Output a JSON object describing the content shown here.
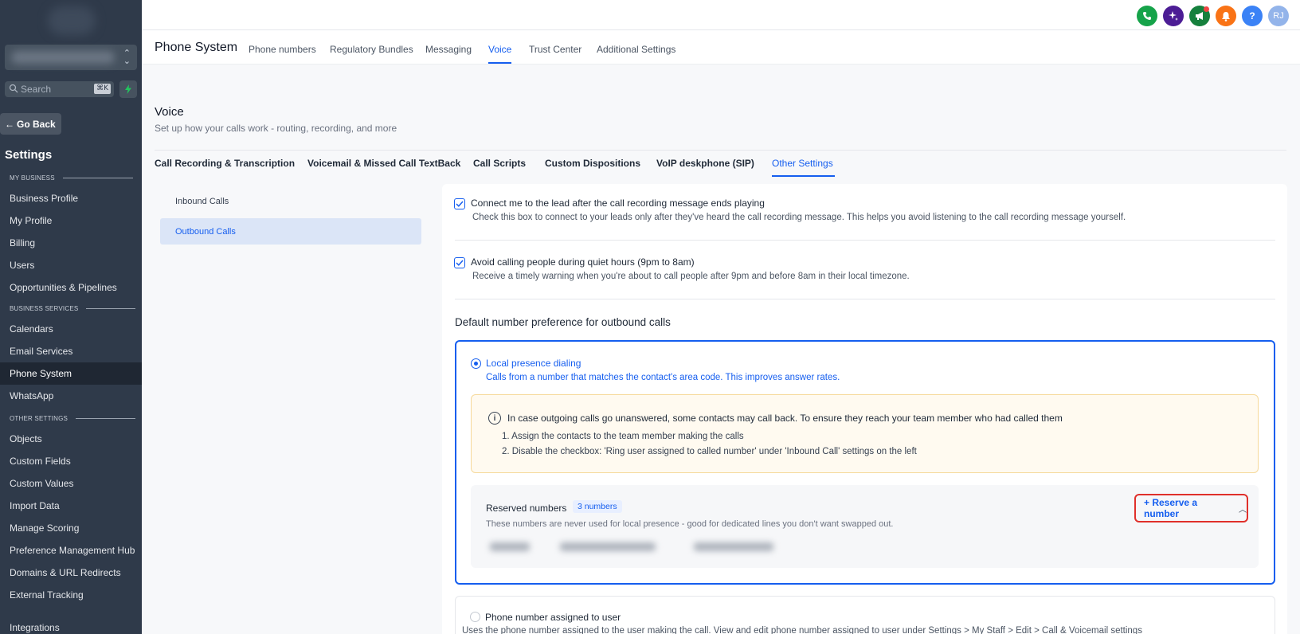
{
  "sidebar": {
    "search_placeholder": "Search",
    "search_shortcut": "⌘K",
    "go_back": "Go Back",
    "settings_title": "Settings",
    "sections": {
      "my_business": "MY BUSINESS",
      "business_services": "BUSINESS SERVICES",
      "other_settings": "OTHER SETTINGS"
    },
    "items": [
      {
        "label": "Business Profile"
      },
      {
        "label": "My Profile"
      },
      {
        "label": "Billing"
      },
      {
        "label": "Users"
      },
      {
        "label": "Opportunities & Pipelines"
      },
      {
        "label": "Calendars"
      },
      {
        "label": "Email Services"
      },
      {
        "label": "Phone System",
        "active": true
      },
      {
        "label": "WhatsApp"
      },
      {
        "label": "Objects"
      },
      {
        "label": "Custom Fields"
      },
      {
        "label": "Custom Values"
      },
      {
        "label": "Import Data"
      },
      {
        "label": "Manage Scoring"
      },
      {
        "label": "Preference Management Hub"
      },
      {
        "label": "Domains & URL Redirects"
      },
      {
        "label": "External Tracking"
      },
      {
        "label": "Integrations"
      }
    ]
  },
  "topbar": {
    "icons": [
      {
        "name": "phone-icon",
        "color": "#16a34a"
      },
      {
        "name": "sparkle-icon",
        "color": "#4c1d95"
      },
      {
        "name": "megaphone-icon",
        "color": "#15803d"
      },
      {
        "name": "bell-icon",
        "color": "#f97316"
      },
      {
        "name": "help-icon",
        "color": "#3b82f6"
      }
    ],
    "avatar_initials": "RJ"
  },
  "subnav": {
    "title": "Phone System",
    "tabs": [
      "Phone numbers",
      "Regulatory Bundles",
      "Messaging",
      "Voice",
      "Trust Center",
      "Additional Settings"
    ],
    "active_tab": "Voice"
  },
  "voice": {
    "title": "Voice",
    "subtitle": "Set up how your calls work - routing, recording, and more",
    "tabs": [
      "Call Recording & Transcription",
      "Voicemail & Missed Call TextBack",
      "Call Scripts",
      "Custom Dispositions",
      "VoIP deskphone (SIP)",
      "Other Settings"
    ],
    "active_tab": "Other Settings"
  },
  "left_menu": {
    "items": [
      "Inbound Calls",
      "Outbound Calls"
    ],
    "active": "Outbound Calls"
  },
  "options": {
    "connect": {
      "title": "Connect me to the lead after the call recording message ends playing",
      "desc": "Check this box to connect to your leads only after they've heard the call recording message. This helps you avoid listening to the call recording message yourself.",
      "checked": true
    },
    "quiet": {
      "title": "Avoid calling people during quiet hours (9pm to 8am)",
      "desc": "Receive a timely warning when you're about to call people after 9pm and before 8am in their local timezone.",
      "checked": true
    }
  },
  "default_number": {
    "heading": "Default number preference for outbound calls",
    "local": {
      "title": "Local presence dialing",
      "desc": "Calls from a number that matches the contact's area code. This improves answer rates.",
      "selected": true
    },
    "warning": {
      "title": "In case outgoing calls go unanswered, some contacts may call back. To ensure they reach your team member who had called them",
      "steps": [
        "1. Assign the contacts to the team member making the calls",
        "2. Disable the checkbox: 'Ring user assigned to called number' under 'Inbound Call' settings on the left"
      ]
    },
    "reserved": {
      "title": "Reserved numbers",
      "badge": "3 numbers",
      "desc": "These numbers are never used for local presence - good for dedicated lines you don't want swapped out.",
      "button": "+ Reserve a number"
    },
    "assigned": {
      "title": "Phone number assigned to user",
      "desc": "Uses the phone number assigned to the user making the call. View and edit phone number assigned to user under Settings > My Staff > Edit > Call & Voicemail settings",
      "selected": false
    }
  }
}
